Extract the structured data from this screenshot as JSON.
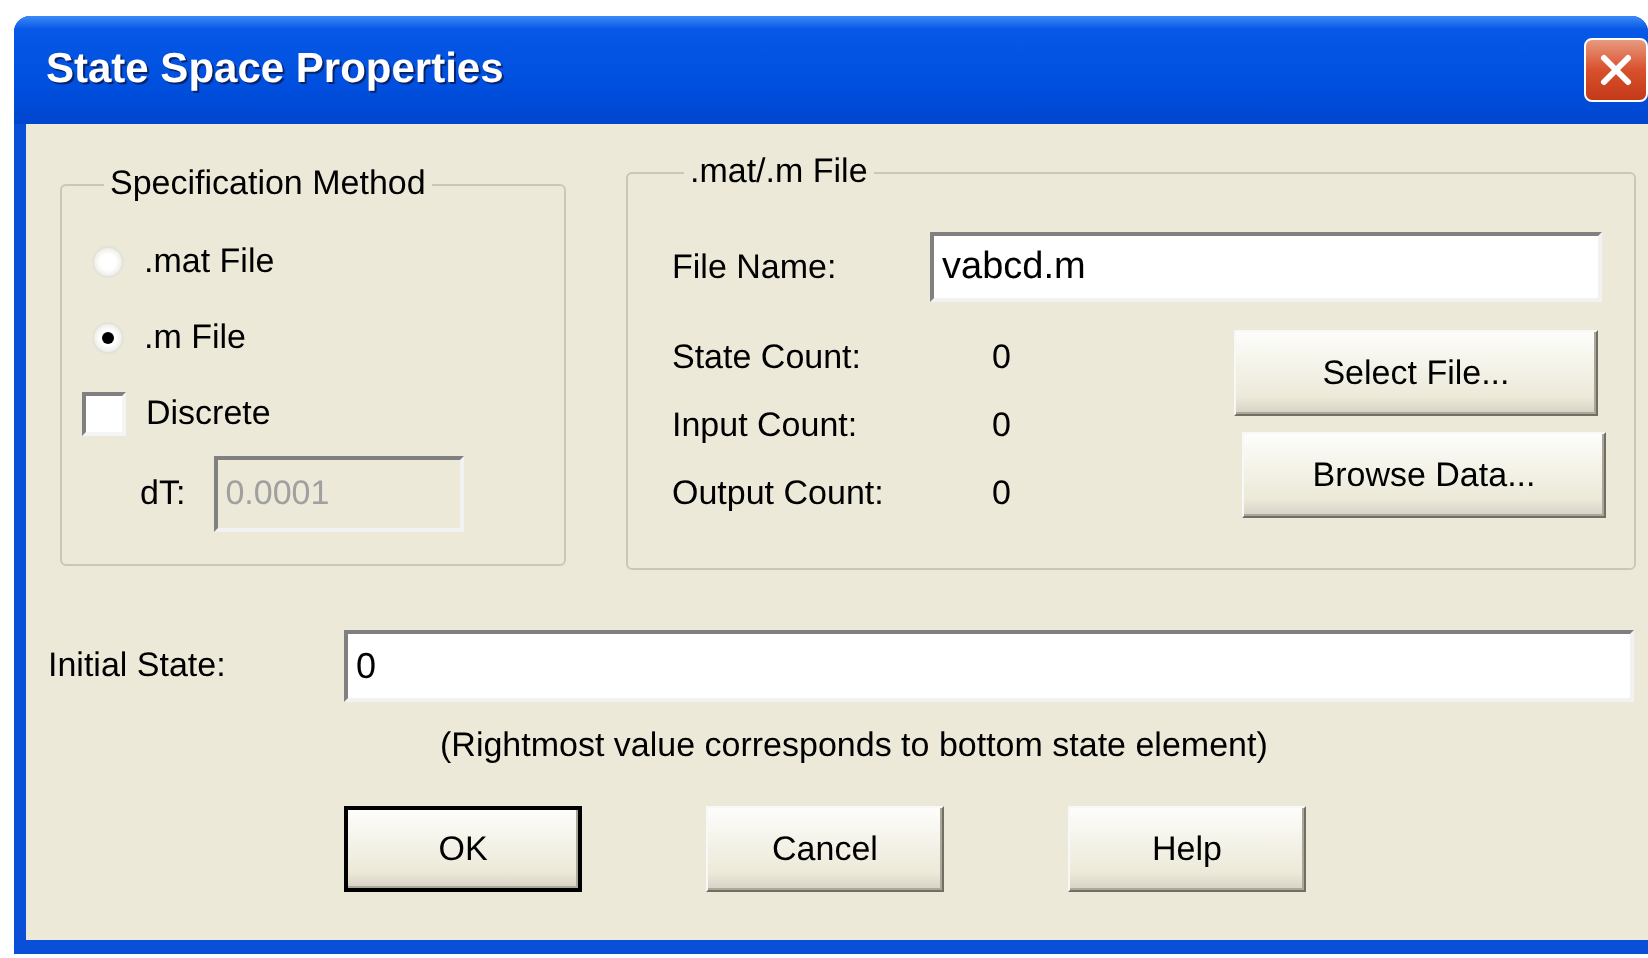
{
  "window": {
    "title": "State Space Properties"
  },
  "specification_method": {
    "title": "Specification Method",
    "options": [
      {
        "label": ".mat File",
        "selected": false
      },
      {
        "label": ".m File",
        "selected": true
      }
    ],
    "discrete": {
      "label": "Discrete",
      "checked": false
    },
    "dt": {
      "label": "dT:",
      "value": "0.0001",
      "disabled": true
    }
  },
  "file_group": {
    "title": ".mat/.m File",
    "file_name": {
      "label": "File Name:",
      "value": "vabcd.m"
    },
    "counts": [
      {
        "label": "State Count:",
        "value": "0"
      },
      {
        "label": "Input Count:",
        "value": "0"
      },
      {
        "label": "Output Count:",
        "value": "0"
      }
    ],
    "buttons": [
      "Select File...",
      "Browse Data..."
    ]
  },
  "initial_state": {
    "label": "Initial State:",
    "value": "0",
    "note": "(Rightmost value corresponds to bottom state element)"
  },
  "buttons": [
    {
      "label": "OK",
      "default": true
    },
    {
      "label": "Cancel",
      "default": false
    },
    {
      "label": "Help",
      "default": false
    }
  ]
}
